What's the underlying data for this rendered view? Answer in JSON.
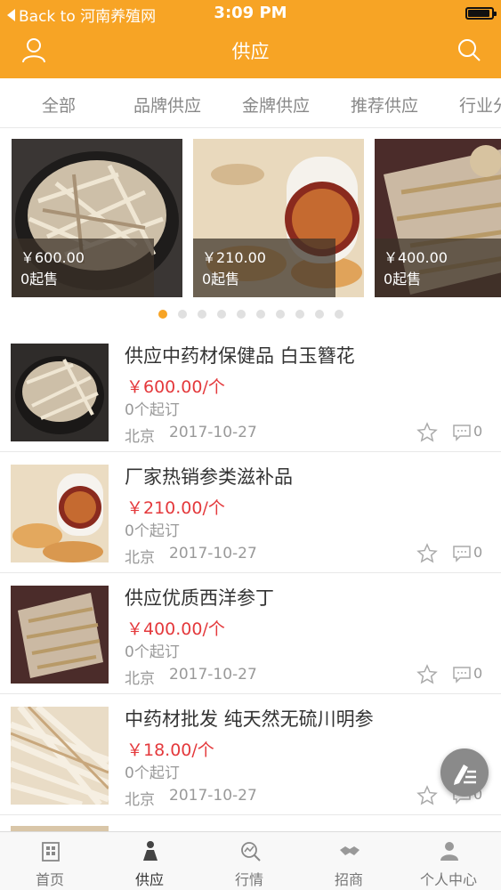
{
  "status_bar": {
    "back_label": "Back to 河南养殖网",
    "time": "3:09 PM"
  },
  "header": {
    "title": "供应",
    "left_icon": "user-icon",
    "right_icon": "search-icon"
  },
  "tabs": [
    "全部",
    "品牌供应",
    "金牌供应",
    "推荐供应",
    "行业分"
  ],
  "carousel": {
    "cards": [
      {
        "price": "￥600.00",
        "moq": "0起售"
      },
      {
        "price": "￥210.00",
        "moq": "0起售"
      },
      {
        "price": "￥400.00",
        "moq": "0起售"
      }
    ],
    "dot_count": 10,
    "active_dot": 0
  },
  "list": [
    {
      "title": "供应中药材保健品 白玉簪花",
      "price": "￥600.00/个",
      "moq": "0个起订",
      "location": "北京",
      "date": "2017-10-27",
      "comments": "0"
    },
    {
      "title": "厂家热销参类滋补品",
      "price": "￥210.00/个",
      "moq": "0个起订",
      "location": "北京",
      "date": "2017-10-27",
      "comments": "0"
    },
    {
      "title": "供应优质西洋参丁",
      "price": "￥400.00/个",
      "moq": "0个起订",
      "location": "北京",
      "date": "2017-10-27",
      "comments": "0"
    },
    {
      "title": "中药材批发 纯天然无硫川明参",
      "price": "￥18.00/个",
      "moq": "0个起订",
      "location": "北京",
      "date": "2017-10-27",
      "comments": "0"
    }
  ],
  "tabbar": [
    {
      "label": "首页",
      "icon": "home-icon"
    },
    {
      "label": "供应",
      "icon": "supply-icon"
    },
    {
      "label": "行情",
      "icon": "market-icon"
    },
    {
      "label": "招商",
      "icon": "handshake-icon"
    },
    {
      "label": "个人中心",
      "icon": "profile-icon"
    }
  ],
  "colors": {
    "accent": "#f7a425",
    "price": "#e4393c"
  }
}
